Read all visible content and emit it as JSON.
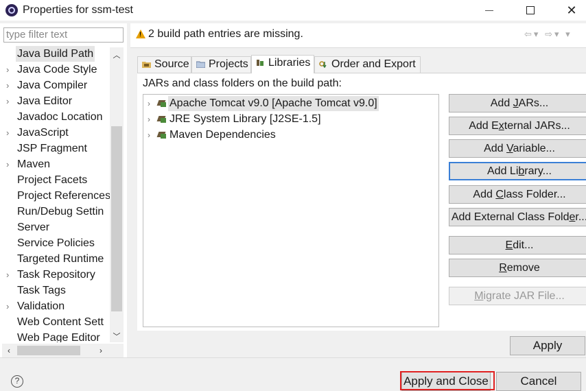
{
  "window": {
    "title": "Properties for ssm-test"
  },
  "sidebar": {
    "filter_placeholder": "type filter text",
    "items": [
      {
        "label": "Java Build Path",
        "expandable": false,
        "selected": true
      },
      {
        "label": "Java Code Style",
        "expandable": true
      },
      {
        "label": "Java Compiler",
        "expandable": true
      },
      {
        "label": "Java Editor",
        "expandable": true
      },
      {
        "label": "Javadoc Location",
        "expandable": false
      },
      {
        "label": "JavaScript",
        "expandable": true
      },
      {
        "label": "JSP Fragment",
        "expandable": false
      },
      {
        "label": "Maven",
        "expandable": true
      },
      {
        "label": "Project Facets",
        "expandable": false
      },
      {
        "label": "Project References",
        "expandable": false
      },
      {
        "label": "Run/Debug Settin",
        "expandable": false
      },
      {
        "label": "Server",
        "expandable": false
      },
      {
        "label": "Service Policies",
        "expandable": false
      },
      {
        "label": "Targeted Runtime",
        "expandable": false
      },
      {
        "label": "Task Repository",
        "expandable": true
      },
      {
        "label": "Task Tags",
        "expandable": false
      },
      {
        "label": "Validation",
        "expandable": true
      },
      {
        "label": "Web Content Sett",
        "expandable": false
      },
      {
        "label": "Web Page Editor",
        "expandable": false
      }
    ]
  },
  "message": {
    "text": "2 build path entries are missing."
  },
  "tabs": [
    {
      "label": "Source"
    },
    {
      "label": "Projects"
    },
    {
      "label": "Libraries",
      "active": true
    },
    {
      "label": "Order and Export"
    }
  ],
  "libraries": {
    "header": "JARs and class folders on the build path:",
    "entries": [
      {
        "label": "Apache Tomcat v9.0 [Apache Tomcat v9.0]",
        "selected": true
      },
      {
        "label": "JRE System Library [J2SE-1.5]"
      },
      {
        "label": "Maven Dependencies"
      }
    ]
  },
  "buttons": {
    "add_jars": {
      "pre": "Add ",
      "u": "J",
      "post": "ARs..."
    },
    "add_external_jars": {
      "pre": "Add E",
      "u": "x",
      "post": "ternal JARs..."
    },
    "add_variable": {
      "pre": "Add ",
      "u": "V",
      "post": "ariable..."
    },
    "add_library": {
      "pre": "Add Li",
      "u": "b",
      "post": "rary..."
    },
    "add_class_folder": {
      "pre": "Add ",
      "u": "C",
      "post": "lass Folder..."
    },
    "add_external_class_folder": {
      "pre": "Add External Class Fold",
      "u": "e",
      "post": "r..."
    },
    "edit": {
      "pre": "",
      "u": "E",
      "post": "dit..."
    },
    "remove": {
      "pre": "",
      "u": "R",
      "post": "emove"
    },
    "migrate_jar": {
      "pre": "",
      "u": "M",
      "post": "igrate JAR File..."
    },
    "apply": "Apply",
    "apply_and_close": "Apply and Close",
    "cancel": "Cancel"
  },
  "colors": {
    "highlight_box": "#e02020",
    "focus_border": "#3a7fd6",
    "warning": "#e8a100"
  }
}
